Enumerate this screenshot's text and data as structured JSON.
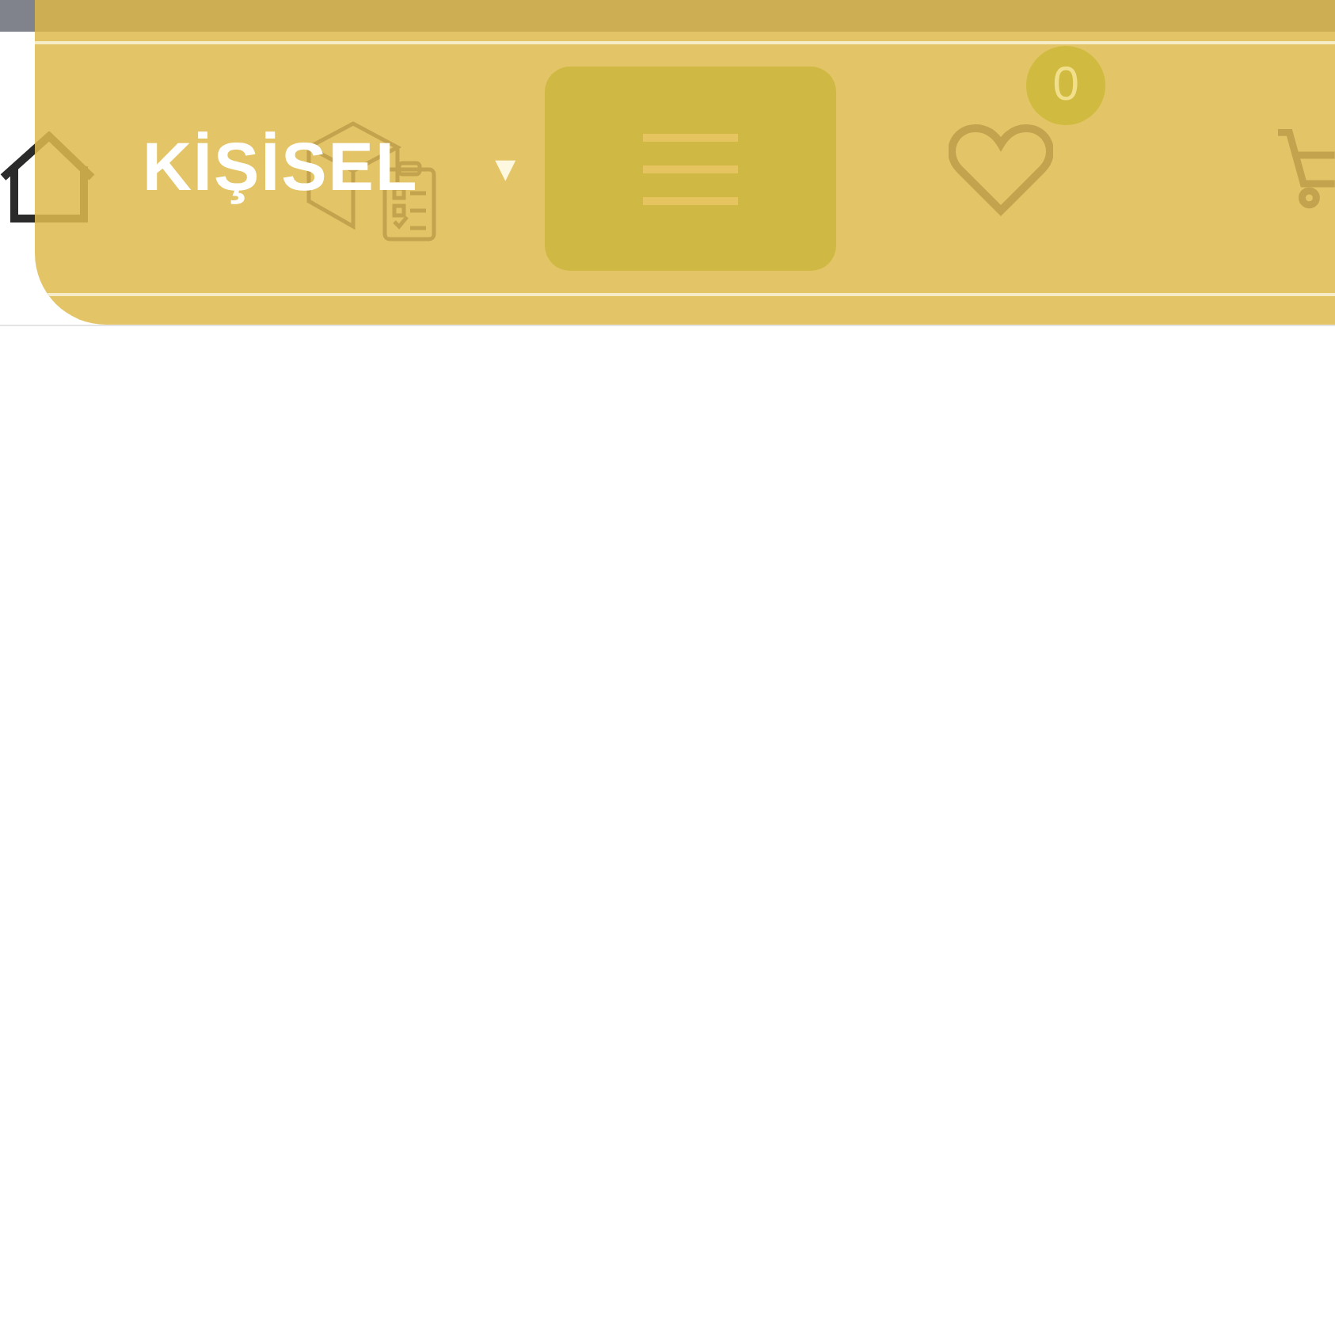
{
  "menu_title": "KİŞİSEL",
  "dropdown_glyph": "▼",
  "favorites": {
    "count": "0"
  }
}
